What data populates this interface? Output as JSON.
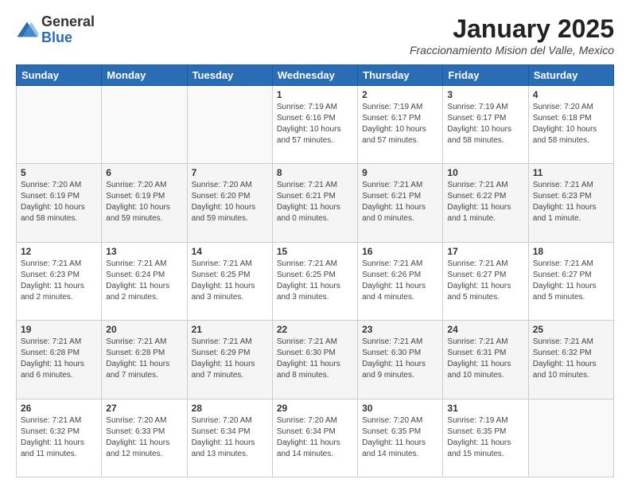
{
  "logo": {
    "general": "General",
    "blue": "Blue"
  },
  "header": {
    "month": "January 2025",
    "subtitle": "Fraccionamiento Mision del Valle, Mexico"
  },
  "days_of_week": [
    "Sunday",
    "Monday",
    "Tuesday",
    "Wednesday",
    "Thursday",
    "Friday",
    "Saturday"
  ],
  "weeks": [
    [
      {
        "day": "",
        "info": ""
      },
      {
        "day": "",
        "info": ""
      },
      {
        "day": "",
        "info": ""
      },
      {
        "day": "1",
        "info": "Sunrise: 7:19 AM\nSunset: 6:16 PM\nDaylight: 10 hours and 57 minutes."
      },
      {
        "day": "2",
        "info": "Sunrise: 7:19 AM\nSunset: 6:17 PM\nDaylight: 10 hours and 57 minutes."
      },
      {
        "day": "3",
        "info": "Sunrise: 7:19 AM\nSunset: 6:17 PM\nDaylight: 10 hours and 58 minutes."
      },
      {
        "day": "4",
        "info": "Sunrise: 7:20 AM\nSunset: 6:18 PM\nDaylight: 10 hours and 58 minutes."
      }
    ],
    [
      {
        "day": "5",
        "info": "Sunrise: 7:20 AM\nSunset: 6:19 PM\nDaylight: 10 hours and 58 minutes."
      },
      {
        "day": "6",
        "info": "Sunrise: 7:20 AM\nSunset: 6:19 PM\nDaylight: 10 hours and 59 minutes."
      },
      {
        "day": "7",
        "info": "Sunrise: 7:20 AM\nSunset: 6:20 PM\nDaylight: 10 hours and 59 minutes."
      },
      {
        "day": "8",
        "info": "Sunrise: 7:21 AM\nSunset: 6:21 PM\nDaylight: 11 hours and 0 minutes."
      },
      {
        "day": "9",
        "info": "Sunrise: 7:21 AM\nSunset: 6:21 PM\nDaylight: 11 hours and 0 minutes."
      },
      {
        "day": "10",
        "info": "Sunrise: 7:21 AM\nSunset: 6:22 PM\nDaylight: 11 hours and 1 minute."
      },
      {
        "day": "11",
        "info": "Sunrise: 7:21 AM\nSunset: 6:23 PM\nDaylight: 11 hours and 1 minute."
      }
    ],
    [
      {
        "day": "12",
        "info": "Sunrise: 7:21 AM\nSunset: 6:23 PM\nDaylight: 11 hours and 2 minutes."
      },
      {
        "day": "13",
        "info": "Sunrise: 7:21 AM\nSunset: 6:24 PM\nDaylight: 11 hours and 2 minutes."
      },
      {
        "day": "14",
        "info": "Sunrise: 7:21 AM\nSunset: 6:25 PM\nDaylight: 11 hours and 3 minutes."
      },
      {
        "day": "15",
        "info": "Sunrise: 7:21 AM\nSunset: 6:25 PM\nDaylight: 11 hours and 3 minutes."
      },
      {
        "day": "16",
        "info": "Sunrise: 7:21 AM\nSunset: 6:26 PM\nDaylight: 11 hours and 4 minutes."
      },
      {
        "day": "17",
        "info": "Sunrise: 7:21 AM\nSunset: 6:27 PM\nDaylight: 11 hours and 5 minutes."
      },
      {
        "day": "18",
        "info": "Sunrise: 7:21 AM\nSunset: 6:27 PM\nDaylight: 11 hours and 5 minutes."
      }
    ],
    [
      {
        "day": "19",
        "info": "Sunrise: 7:21 AM\nSunset: 6:28 PM\nDaylight: 11 hours and 6 minutes."
      },
      {
        "day": "20",
        "info": "Sunrise: 7:21 AM\nSunset: 6:28 PM\nDaylight: 11 hours and 7 minutes."
      },
      {
        "day": "21",
        "info": "Sunrise: 7:21 AM\nSunset: 6:29 PM\nDaylight: 11 hours and 7 minutes."
      },
      {
        "day": "22",
        "info": "Sunrise: 7:21 AM\nSunset: 6:30 PM\nDaylight: 11 hours and 8 minutes."
      },
      {
        "day": "23",
        "info": "Sunrise: 7:21 AM\nSunset: 6:30 PM\nDaylight: 11 hours and 9 minutes."
      },
      {
        "day": "24",
        "info": "Sunrise: 7:21 AM\nSunset: 6:31 PM\nDaylight: 11 hours and 10 minutes."
      },
      {
        "day": "25",
        "info": "Sunrise: 7:21 AM\nSunset: 6:32 PM\nDaylight: 11 hours and 10 minutes."
      }
    ],
    [
      {
        "day": "26",
        "info": "Sunrise: 7:21 AM\nSunset: 6:32 PM\nDaylight: 11 hours and 11 minutes."
      },
      {
        "day": "27",
        "info": "Sunrise: 7:20 AM\nSunset: 6:33 PM\nDaylight: 11 hours and 12 minutes."
      },
      {
        "day": "28",
        "info": "Sunrise: 7:20 AM\nSunset: 6:34 PM\nDaylight: 11 hours and 13 minutes."
      },
      {
        "day": "29",
        "info": "Sunrise: 7:20 AM\nSunset: 6:34 PM\nDaylight: 11 hours and 14 minutes."
      },
      {
        "day": "30",
        "info": "Sunrise: 7:20 AM\nSunset: 6:35 PM\nDaylight: 11 hours and 14 minutes."
      },
      {
        "day": "31",
        "info": "Sunrise: 7:19 AM\nSunset: 6:35 PM\nDaylight: 11 hours and 15 minutes."
      },
      {
        "day": "",
        "info": ""
      }
    ]
  ]
}
